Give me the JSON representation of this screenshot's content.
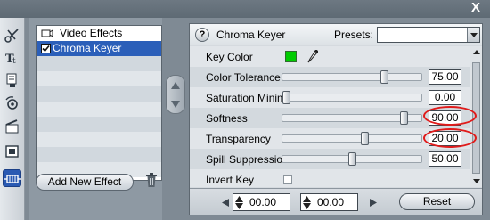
{
  "window": {
    "close_glyph": "X"
  },
  "toolbar": {
    "tools": [
      {
        "icon": "scissors-icon"
      },
      {
        "icon": "text-title-icon"
      },
      {
        "icon": "stamp-icon"
      },
      {
        "icon": "audio-note-icon"
      },
      {
        "icon": "clapper-icon"
      },
      {
        "icon": "frame-icon"
      },
      {
        "icon": "video-effects-icon",
        "active": true
      }
    ],
    "accent": "#2a5ab3"
  },
  "effects_list": {
    "header": "Video Effects",
    "items": [
      {
        "label": "Chroma Keyer",
        "checked": true,
        "selected": true
      }
    ],
    "add_button": "Add New Effect",
    "selection_color": "#2b5fb9"
  },
  "props_panel": {
    "help": "?",
    "title": "Chroma Keyer",
    "presets_label": "Presets:",
    "presets_value": "",
    "key_color": {
      "label": "Key Color",
      "color": "#00cc00"
    },
    "params": [
      {
        "label": "Color Tolerance",
        "value": "75.00",
        "level": 0.75
      },
      {
        "label": "Saturation Minim...",
        "value": "0.00",
        "level": 0.0
      },
      {
        "label": "Softness",
        "value": "90.00",
        "level": 0.9
      },
      {
        "label": "Transparency",
        "value": "20.00",
        "level": 0.6
      },
      {
        "label": "Spill Suppression",
        "value": "50.00",
        "level": 0.5
      }
    ],
    "invert_key": {
      "label": "Invert Key",
      "checked": false
    },
    "footer": {
      "start_time": "00.00",
      "end_time": "00.00",
      "reset_button": "Reset"
    },
    "annotation_color": "#e01b1b"
  }
}
